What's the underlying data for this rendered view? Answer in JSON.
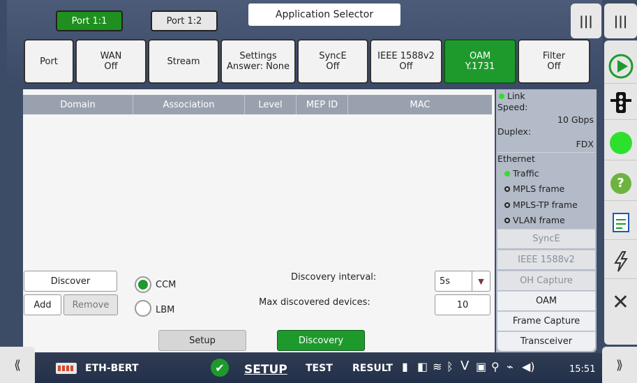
{
  "ports": [
    "Port 1:1",
    "Port 1:2"
  ],
  "app_selector": "Application Selector",
  "tabs": [
    {
      "line1": "Port",
      "line2": ""
    },
    {
      "line1": "WAN",
      "line2": "Off"
    },
    {
      "line1": "Stream",
      "line2": ""
    },
    {
      "line1": "Settings",
      "line2": "Answer: None"
    },
    {
      "line1": "SyncE",
      "line2": "Off"
    },
    {
      "line1": "IEEE 1588v2",
      "line2": "Off"
    },
    {
      "line1": "OAM",
      "line2": "Y.1731"
    },
    {
      "line1": "Filter",
      "line2": "Off"
    }
  ],
  "table": {
    "headers": [
      "Domain",
      "Association",
      "Level",
      "MEP ID",
      "MAC"
    ]
  },
  "controls": {
    "discover": "Discover",
    "add": "Add",
    "remove": "Remove",
    "ccm": "CCM",
    "lbm": "LBM",
    "discovery_interval_label": "Discovery interval:",
    "discovery_interval_value": "5s",
    "max_devices_label": "Max discovered devices:",
    "max_devices_value": "10",
    "setup": "Setup",
    "discovery": "Discovery"
  },
  "status": {
    "link": "Link",
    "speed_label": "Speed:",
    "speed_value": "10 Gbps",
    "duplex_label": "Duplex:",
    "duplex_value": "FDX",
    "ethernet": "Ethernet",
    "traffic": "Traffic",
    "mpls": "MPLS frame",
    "mplstp": "MPLS-TP frame",
    "vlan": "VLAN frame",
    "rows": [
      "SyncE",
      "IEEE 1588v2",
      "OH Capture",
      "OAM",
      "Frame Capture",
      "Transceiver"
    ]
  },
  "taskbar": {
    "app": "ETH-BERT",
    "setup": "SETUP",
    "test": "TEST",
    "result": "RESULT",
    "time": "15:51"
  },
  "colors": {
    "accent_green": "#1e9a2c",
    "header_gray": "#9aa1ae"
  }
}
